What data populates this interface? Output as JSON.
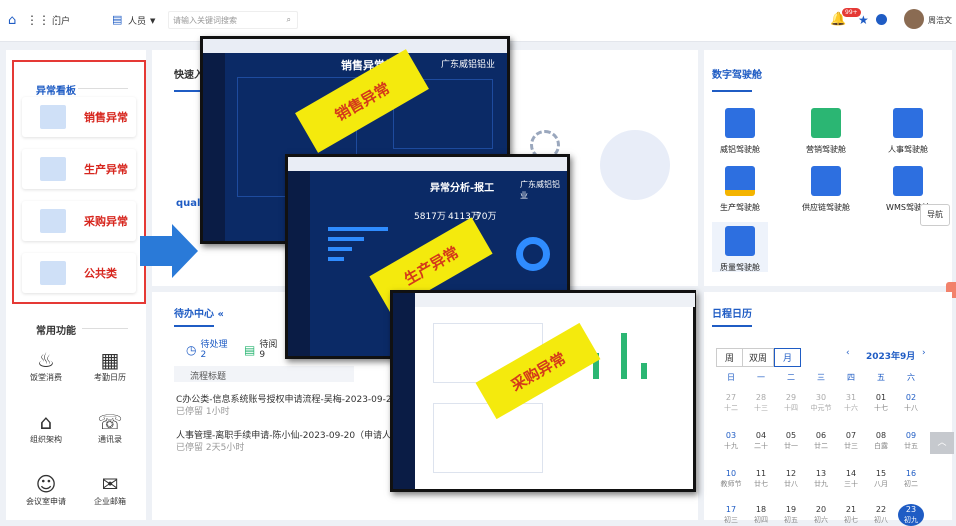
{
  "topbar": {
    "portal_label": "门户",
    "search_scope": "人员",
    "search_placeholder": "请输入关键词搜索",
    "notif_count": "99+",
    "user_name": "周浩文"
  },
  "exceptions": {
    "title": "异常看板",
    "items": [
      {
        "label": "销售异常"
      },
      {
        "label": "生产异常"
      },
      {
        "label": "采购异常"
      },
      {
        "label": "公共类"
      }
    ]
  },
  "functions": {
    "title": "常用功能",
    "items": [
      {
        "label": "饭堂消费",
        "icon": "dining-icon"
      },
      {
        "label": "考勤日历",
        "icon": "calendar-icon"
      },
      {
        "label": "组织架构",
        "icon": "org-icon"
      },
      {
        "label": "通讯录",
        "icon": "phone-icon"
      },
      {
        "label": "会议室申请",
        "icon": "meeting-icon"
      },
      {
        "label": "企业邮箱",
        "icon": "mail-icon"
      }
    ]
  },
  "quick": {
    "title": "快速入口",
    "quality": "quality"
  },
  "todo": {
    "title": "待办中心",
    "tab_pending": "待处理",
    "tab_pending_count": "2",
    "tab_read": "待阅",
    "tab_read_count": "9",
    "col_header": "流程标题",
    "items": [
      {
        "title": "C办公类-信息系统账号授权申请流程-吴梅-2023-09-23",
        "meta": "已停留 1小时"
      },
      {
        "title": "人事管理-离职手续申请-陈小仙-2023-09-20（申请人姓名:陈小华）",
        "meta": "已停留 2天5小时"
      }
    ]
  },
  "digital": {
    "title": "数字驾驶舱",
    "items": [
      {
        "label": "威铝驾驶舱",
        "color": "#2d6fe0"
      },
      {
        "label": "营销驾驶舱",
        "color": "#2bb673"
      },
      {
        "label": "人事驾驶舱",
        "color": "#2d6fe0"
      },
      {
        "label": "生产驾驶舱",
        "color": "#f4b400"
      },
      {
        "label": "供应链驾驶舱",
        "color": "#2d6fe0"
      },
      {
        "label": "WMS驾驶舱",
        "color": "#2d6fe0"
      },
      {
        "label": "质量驾驶舱",
        "color": "#2d6fe0"
      }
    ],
    "nav_button": "导航"
  },
  "calendar": {
    "title": "日程日历",
    "views": [
      "周",
      "双周",
      "月"
    ],
    "month": "2023年9月",
    "weekdays": [
      "日",
      "一",
      "二",
      "三",
      "四",
      "五",
      "六"
    ],
    "weeks": [
      [
        [
          "27",
          "十二"
        ],
        [
          "28",
          "十三"
        ],
        [
          "29",
          "十四"
        ],
        [
          "30",
          "中元节"
        ],
        [
          "31",
          "十六"
        ],
        [
          "01",
          "十七"
        ],
        [
          "02",
          "十八"
        ]
      ],
      [
        [
          "03",
          "十九"
        ],
        [
          "04",
          "二十"
        ],
        [
          "05",
          "廿一"
        ],
        [
          "06",
          "廿二"
        ],
        [
          "07",
          "廿三"
        ],
        [
          "08",
          "白露"
        ],
        [
          "09",
          "廿五"
        ]
      ],
      [
        [
          "10",
          "教师节"
        ],
        [
          "11",
          "廿七"
        ],
        [
          "12",
          "廿八"
        ],
        [
          "13",
          "廿九"
        ],
        [
          "14",
          "三十"
        ],
        [
          "15",
          "八月"
        ],
        [
          "16",
          "初二"
        ]
      ],
      [
        [
          "17",
          "初三"
        ],
        [
          "18",
          "初四"
        ],
        [
          "19",
          "初五"
        ],
        [
          "20",
          "初六"
        ],
        [
          "21",
          "初七"
        ],
        [
          "22",
          "初八"
        ],
        [
          "23",
          "初九"
        ]
      ]
    ]
  },
  "overlays": {
    "sales": {
      "title": "销售异常报表",
      "org": "广东威铝铝业",
      "sticker": "销售异常"
    },
    "production": {
      "title": "异常分析-报工",
      "org": "广东威铝铝业",
      "sticker": "生产异常",
      "kpi1": "5817万",
      "kpi2": "4113万",
      "kpi3": "70万"
    },
    "purchase": {
      "sticker": "采购异常"
    }
  },
  "accent": "#1f5cc4"
}
